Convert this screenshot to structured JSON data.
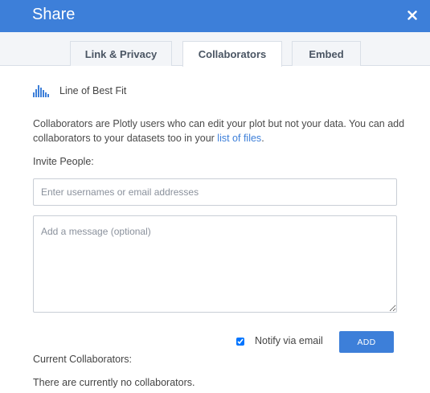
{
  "header": {
    "title": "Share",
    "close_icon": "close-icon",
    "color": "#3d7fd9"
  },
  "tabs": [
    {
      "label": "Link & Privacy",
      "active": false
    },
    {
      "label": "Collaborators",
      "active": true
    },
    {
      "label": "Embed",
      "active": false
    }
  ],
  "plot": {
    "icon": "bar-chart-icon",
    "name": "Line of Best Fit"
  },
  "description": {
    "text": "Collaborators are Plotly users who can edit your plot but not your data. You can add collaborators to your datasets too in your ",
    "link_text": "list of files",
    "suffix": "."
  },
  "invite": {
    "label": "Invite People:",
    "users_placeholder": "Enter usernames or email addresses",
    "message_placeholder": "Add a message (optional)"
  },
  "notify": {
    "label": "Notify via email",
    "checked": true
  },
  "add_button": {
    "label": "ADD"
  },
  "current": {
    "label": "Current Collaborators:",
    "empty_text": "There are currently no collaborators."
  }
}
